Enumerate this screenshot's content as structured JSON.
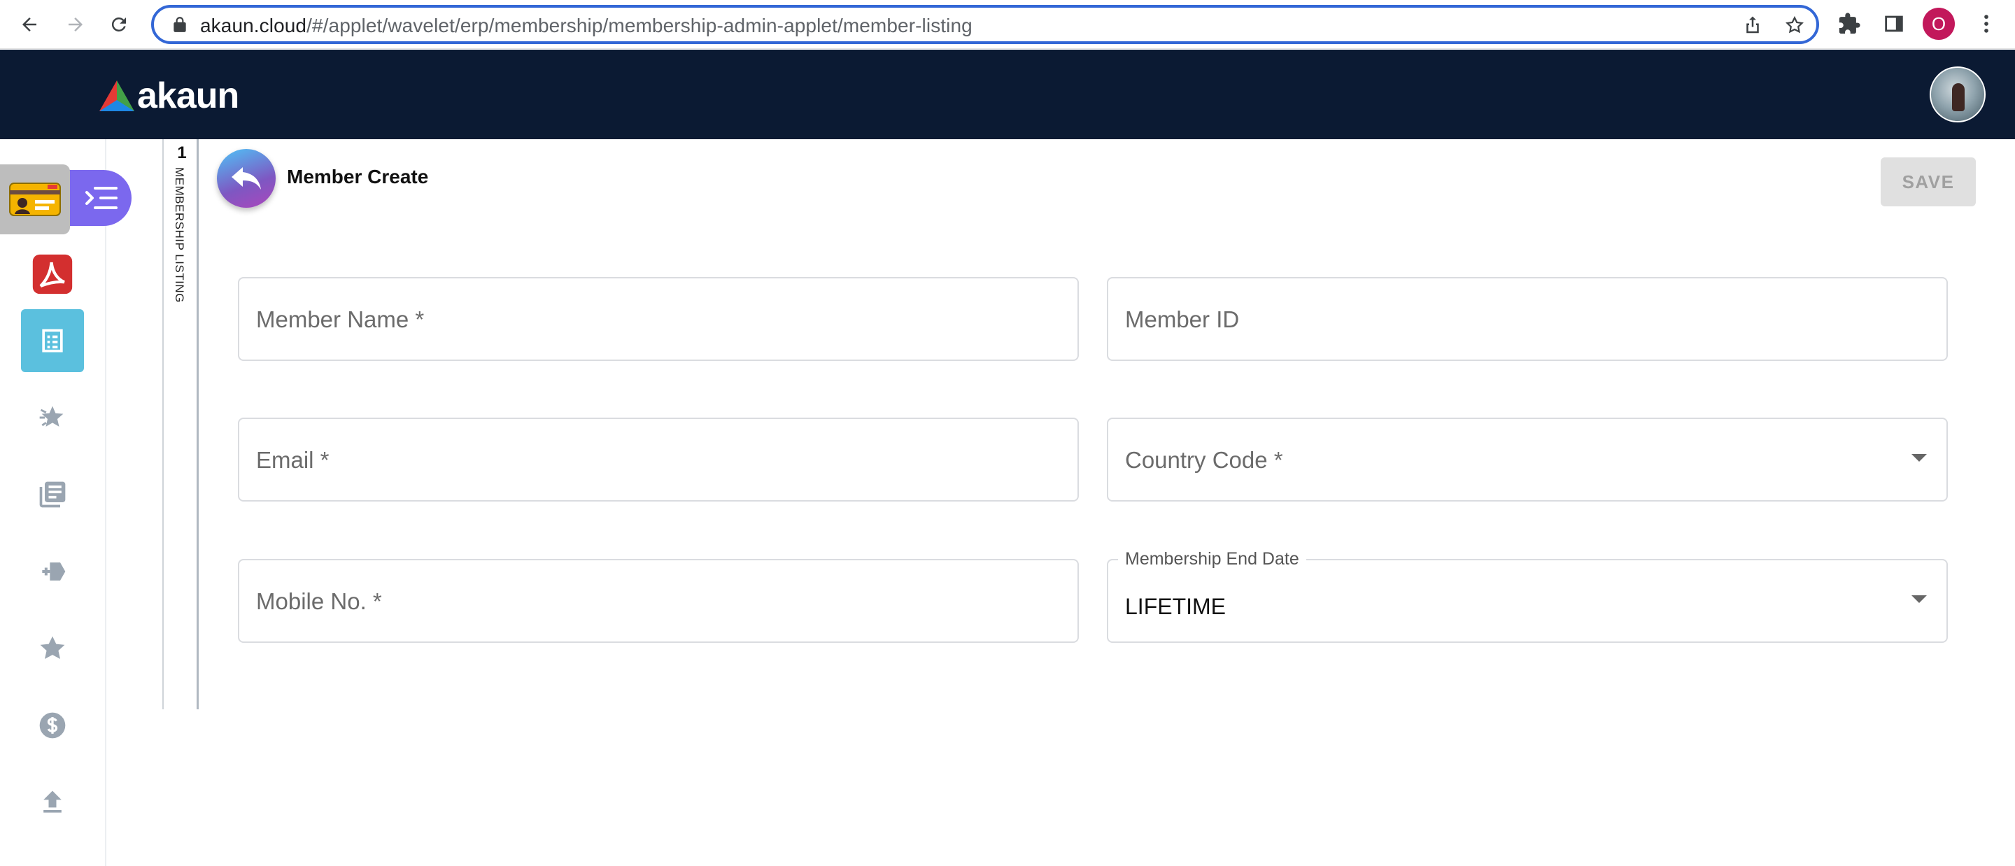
{
  "browser": {
    "url_host": "akaun.cloud",
    "url_path": "/#/applet/wavelet/erp/membership/membership-admin-applet/member-listing",
    "profile_initial": "O"
  },
  "app": {
    "logo_text": "akaun"
  },
  "tabs": {
    "number": "1",
    "label": "MEMBERSHIP LISTING"
  },
  "page": {
    "title": "Member Create",
    "save_label": "SAVE"
  },
  "form": {
    "member_name_placeholder": "Member Name *",
    "member_id_placeholder": "Member ID",
    "email_placeholder": "Email *",
    "country_code_placeholder": "Country Code *",
    "mobile_placeholder": "Mobile No. *",
    "end_date_label": "Membership End Date",
    "end_date_value": "LIFETIME"
  },
  "colors": {
    "header_bg": "#0b1a33",
    "accent_purple": "#7b68ee",
    "accent_teal": "#5bc0de",
    "omnibox_focus": "#3367d6"
  }
}
